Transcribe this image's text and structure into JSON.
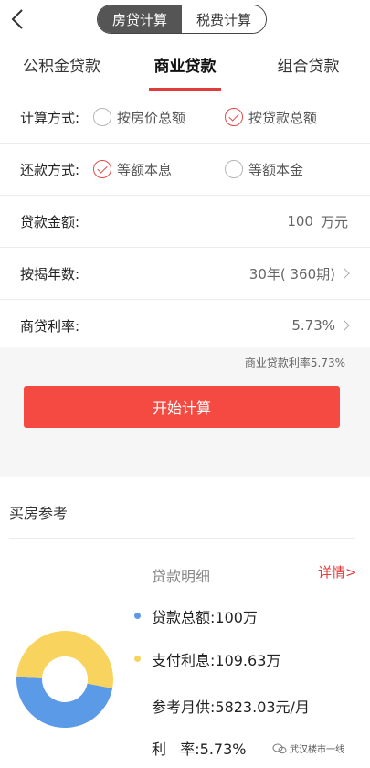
{
  "header": {
    "segments": [
      {
        "label": "房贷计算",
        "active": true
      },
      {
        "label": "税费计算",
        "active": false
      }
    ]
  },
  "tabs": [
    {
      "label": "公积金贷款",
      "active": false
    },
    {
      "label": "商业贷款",
      "active": true
    },
    {
      "label": "组合贷款",
      "active": false
    }
  ],
  "form": {
    "calc_method": {
      "label": "计算方式:",
      "options": [
        {
          "label": "按房价总额",
          "checked": false
        },
        {
          "label": "按贷款总额",
          "checked": true
        }
      ]
    },
    "repay_method": {
      "label": "还款方式:",
      "options": [
        {
          "label": "等额本息",
          "checked": true
        },
        {
          "label": "等额本金",
          "checked": false
        }
      ]
    },
    "loan_amount": {
      "label": "贷款金额:",
      "value": "100",
      "unit": "万元"
    },
    "years": {
      "label": "按揭年数:",
      "value": "30年( 360期)"
    },
    "rate": {
      "label": "商贷利率:",
      "value": "5.73%"
    }
  },
  "hint": "商业贷款利率5.73%",
  "start_button": "开始计算",
  "reference": {
    "title": "买房参考",
    "detail_title": "贷款明细",
    "detail_link": "详情>",
    "items": [
      {
        "text": "贷款总额:100万",
        "dot_color": "#5b9ae6"
      },
      {
        "text": "支付利息:109.63万",
        "dot_color": "#f8d45e"
      },
      {
        "text": "参考月供:5823.03元/月"
      },
      {
        "text": "利   率:5.73%"
      }
    ],
    "donut": {
      "principal": 100,
      "interest": 109.63,
      "principal_color": "#5b9ae6",
      "interest_color": "#f8d45e"
    }
  },
  "watermark": "武汉楼市一线"
}
